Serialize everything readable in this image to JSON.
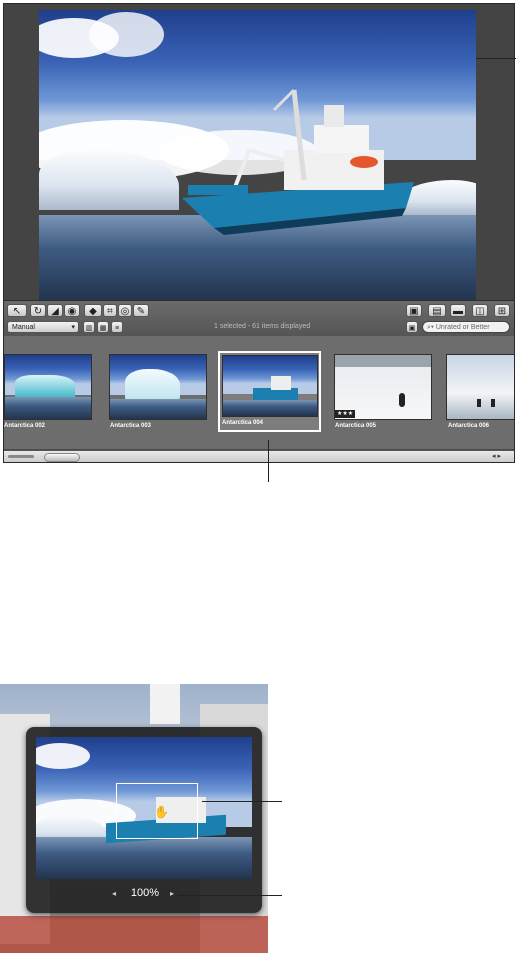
{
  "toolbar": {
    "sort_menu_value": "Manual",
    "status_text": "1 selected - 61 items displayed",
    "search_placeholder": "Unrated or Better"
  },
  "browser": {
    "thumbnails": [
      {
        "label": "Antarctica 002",
        "rating": ""
      },
      {
        "label": "Antarctica 003",
        "rating": ""
      },
      {
        "label": "Antarctica 004",
        "rating": "",
        "selected": true
      },
      {
        "label": "Antarctica 005",
        "rating": "★★★"
      },
      {
        "label": "Antarctica 006",
        "rating": ""
      }
    ]
  },
  "zoom_hud": {
    "zoom_level": "100%"
  },
  "icons": [
    "select-arrow-icon",
    "rotate-icon",
    "straighten-icon",
    "redeye-icon",
    "lift-stamp-icon",
    "crop-icon",
    "preview-eye-icon",
    "brush-icon",
    "viewer-browser-mode-icon",
    "show-metadata-icon",
    "adjust-icon",
    "full-screen-icon",
    "compare-icon",
    "filmstrip-icon",
    "grid-view-icon",
    "list-view-icon",
    "filter-icon",
    "search-icon",
    "hand-cursor-icon",
    "zoom-left-arrow-icon",
    "zoom-right-arrow-icon"
  ]
}
